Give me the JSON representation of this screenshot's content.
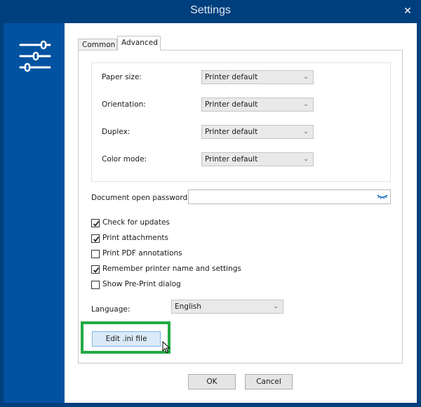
{
  "window": {
    "title": "Settings",
    "close_icon": "close-icon"
  },
  "sidebar": {
    "icon": "sliders-icon",
    "colors": {
      "sidebar": "#0152a0",
      "frame": "#003f7d"
    }
  },
  "tabs": [
    {
      "label": "Common",
      "active": false
    },
    {
      "label": "Advanced",
      "active": true
    }
  ],
  "print_settings": [
    {
      "label": "Paper size:",
      "value": "Printer default"
    },
    {
      "label": "Orientation:",
      "value": "Printer default"
    },
    {
      "label": "Duplex:",
      "value": "Printer default"
    },
    {
      "label": "Color mode:",
      "value": "Printer default"
    }
  ],
  "password": {
    "label": "Document open password:",
    "value": "",
    "toggle_icon": "eye-closed-icon"
  },
  "checkboxes": [
    {
      "label": "Check for updates",
      "checked": true
    },
    {
      "label": "Print attachments",
      "checked": true
    },
    {
      "label": "Print PDF annotations",
      "checked": false
    },
    {
      "label": "Remember printer name and settings",
      "checked": true
    },
    {
      "label": "Show Pre-Print dialog",
      "checked": false
    }
  ],
  "language": {
    "label": "Language:",
    "value": "English"
  },
  "edit_ini_button": {
    "label": "Edit .ini file",
    "highlight_color": "#22aa44"
  },
  "footer": {
    "ok_label": "OK",
    "cancel_label": "Cancel"
  }
}
